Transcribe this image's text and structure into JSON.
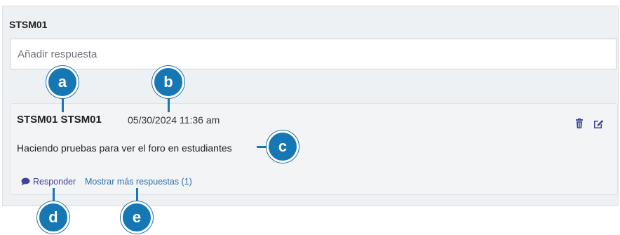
{
  "forum": {
    "title": "STSM01",
    "reply_placeholder": "Añadir respuesta"
  },
  "comment": {
    "author": "STSM01 STSM01",
    "timestamp": "05/30/2024 11:36 am",
    "text": "Haciendo pruebas para ver el foro en estudiantes",
    "reply_label": "Responder",
    "more_replies_label": "Mostrar más respuestas (1)"
  },
  "icons": {
    "delete": "trash-icon",
    "edit": "edit-icon",
    "reply": "speech-bubble-icon"
  },
  "colors": {
    "annotation": "#1677b5",
    "action_icons": "#3f4596",
    "link": "#2e6fa8"
  },
  "annotations": {
    "a": "a",
    "b": "b",
    "c": "c",
    "d": "d",
    "e": "e"
  }
}
